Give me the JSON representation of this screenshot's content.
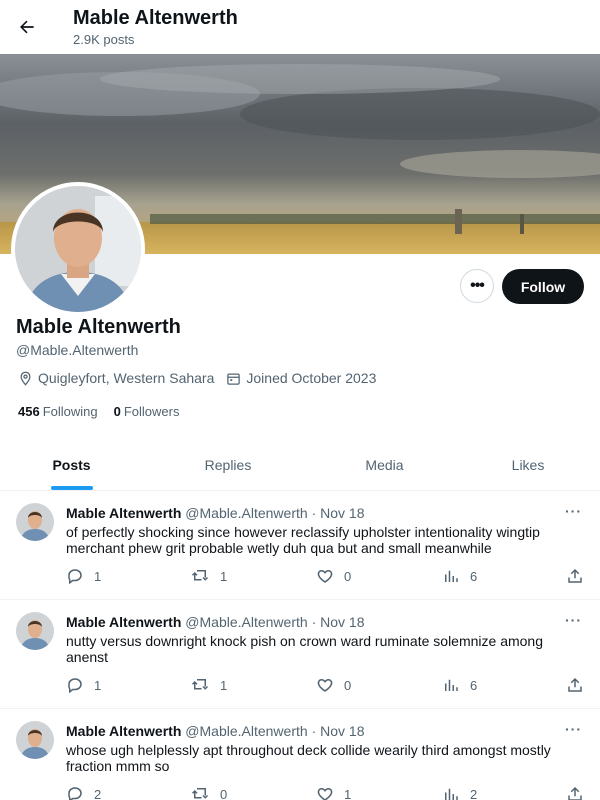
{
  "header": {
    "title": "Mable Altenwerth",
    "post_count": "2.9K posts"
  },
  "profile": {
    "name": "Mable Altenwerth",
    "handle": "@Mable.Altenwerth",
    "location": "Quigleyfort, Western Sahara",
    "joined": "Joined October 2023",
    "following_count": "456",
    "following_label": "Following",
    "followers_count": "0",
    "followers_label": "Followers",
    "follow_label": "Follow",
    "more_label": "•••"
  },
  "tabs": [
    {
      "label": "Posts",
      "active": true
    },
    {
      "label": "Replies",
      "active": false
    },
    {
      "label": "Media",
      "active": false
    },
    {
      "label": "Likes",
      "active": false
    }
  ],
  "posts": [
    {
      "author": "Mable Altenwerth",
      "handle": "@Mable.Altenwerth",
      "dot": "·",
      "date": "Nov 18",
      "text": "of perfectly shocking since however reclassify upholster intentionality wingtip merchant phew grit probable wetly duh qua but and small meanwhile",
      "replies": "1",
      "reposts": "1",
      "likes": "0",
      "views": "6"
    },
    {
      "author": "Mable Altenwerth",
      "handle": "@Mable.Altenwerth",
      "dot": "·",
      "date": "Nov 18",
      "text": "nutty versus downright knock pish on crown ward ruminate solemnize among anenst",
      "replies": "1",
      "reposts": "1",
      "likes": "0",
      "views": "6"
    },
    {
      "author": "Mable Altenwerth",
      "handle": "@Mable.Altenwerth",
      "dot": "·",
      "date": "Nov 18",
      "text": "whose ugh helplessly apt throughout deck collide wearily third amongst mostly fraction mmm so",
      "replies": "2",
      "reposts": "0",
      "likes": "1",
      "views": "2"
    }
  ],
  "post_more_label": "···",
  "colors": {
    "accent": "#1d9bf0",
    "text": "#0f1419",
    "secondary": "#536471",
    "button_dark": "#0f1419"
  },
  "icons": [
    "back-arrow-icon",
    "location-pin-icon",
    "calendar-icon",
    "reply-icon",
    "repost-icon",
    "like-icon",
    "views-icon",
    "share-icon"
  ]
}
